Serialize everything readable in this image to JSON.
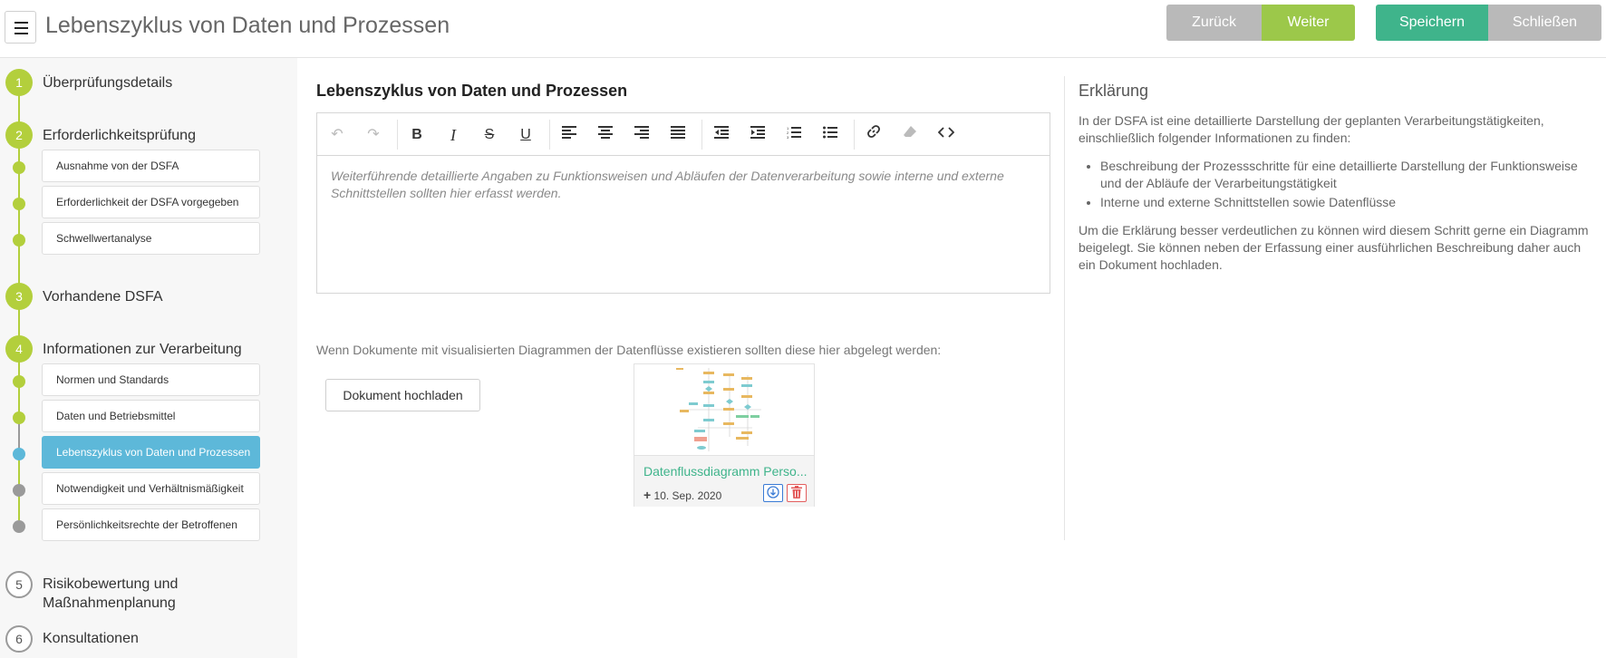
{
  "header": {
    "title": "Lebenszyklus von Daten und Prozessen",
    "back_label": "Zurück",
    "next_label": "Weiter",
    "save_label": "Speichern",
    "close_label": "Schließen"
  },
  "sidebar": {
    "steps": [
      {
        "number": "1",
        "label": "Überprüfungsdetails"
      },
      {
        "number": "2",
        "label": "Erforderlichkeitsprüfung"
      },
      {
        "number": "3",
        "label": "Vorhandene DSFA"
      },
      {
        "number": "4",
        "label": "Informationen zur Verarbeitung"
      },
      {
        "number": "5",
        "label": "Risikobewertung und Maßnahmenplanung"
      },
      {
        "number": "6",
        "label": "Konsultationen"
      }
    ],
    "step2_items": [
      {
        "label": "Ausnahme von der DSFA"
      },
      {
        "label": "Erforderlichkeit der DSFA vorgegeben"
      },
      {
        "label": "Schwellwertanalyse"
      }
    ],
    "step4_items": [
      {
        "label": "Normen und Standards"
      },
      {
        "label": "Daten und Betriebsmittel"
      },
      {
        "label": "Lebenszyklus von Daten und Prozessen"
      },
      {
        "label": "Notwendigkeit und Verhältnismäßigkeit"
      },
      {
        "label": "Persönlichkeitsrechte der Betroffenen"
      }
    ],
    "colors": {
      "done": "#b3cf3c",
      "active": "#5db8d9",
      "pending": "#9a9a9a"
    }
  },
  "main": {
    "heading": "Lebenszyklus von Daten und Prozessen",
    "editor_placeholder": "Weiterführende detaillierte Angaben zu Funktionsweisen und Abläufen der Datenverarbeitung sowie interne und externe Schnittstellen sollten hier erfasst werden.",
    "toolbar_icons": [
      "undo-icon",
      "redo-icon",
      "bold-icon",
      "italic-icon",
      "strikethrough-icon",
      "underline-icon",
      "align-left-icon",
      "align-center-icon",
      "align-right-icon",
      "align-justify-icon",
      "outdent-icon",
      "indent-icon",
      "ordered-list-icon",
      "bullet-list-icon",
      "link-icon",
      "eraser-icon",
      "code-icon"
    ],
    "documents_hint": "Wenn Dokumente mit visualisierten Diagrammen der Datenflüsse existieren sollten diese hier abgelegt werden:",
    "upload_label": "Dokument hochladen",
    "document": {
      "name": "Datenflussdiagramm Perso...",
      "date": "10. Sep. 2020"
    }
  },
  "explanation": {
    "title": "Erklärung",
    "intro": "In der DSFA ist eine detaillierte Darstellung der geplanten Verarbeitungstätigkeiten, einschließlich folgender Informationen zu finden:",
    "bullets": [
      "Beschreibung der Prozessschritte für eine detaillierte Darstellung der Funktionsweise und der Abläufe der Verarbeitungstätigkeit",
      "Interne und externe Schnittstellen sowie Datenflüsse"
    ],
    "outro": "Um die Erklärung besser verdeutlichen zu können wird diesem Schritt gerne ein Diagramm beigelegt. Sie können neben der Erfassung einer ausführlichen Beschreibung daher auch ein Dokument hochladen."
  }
}
